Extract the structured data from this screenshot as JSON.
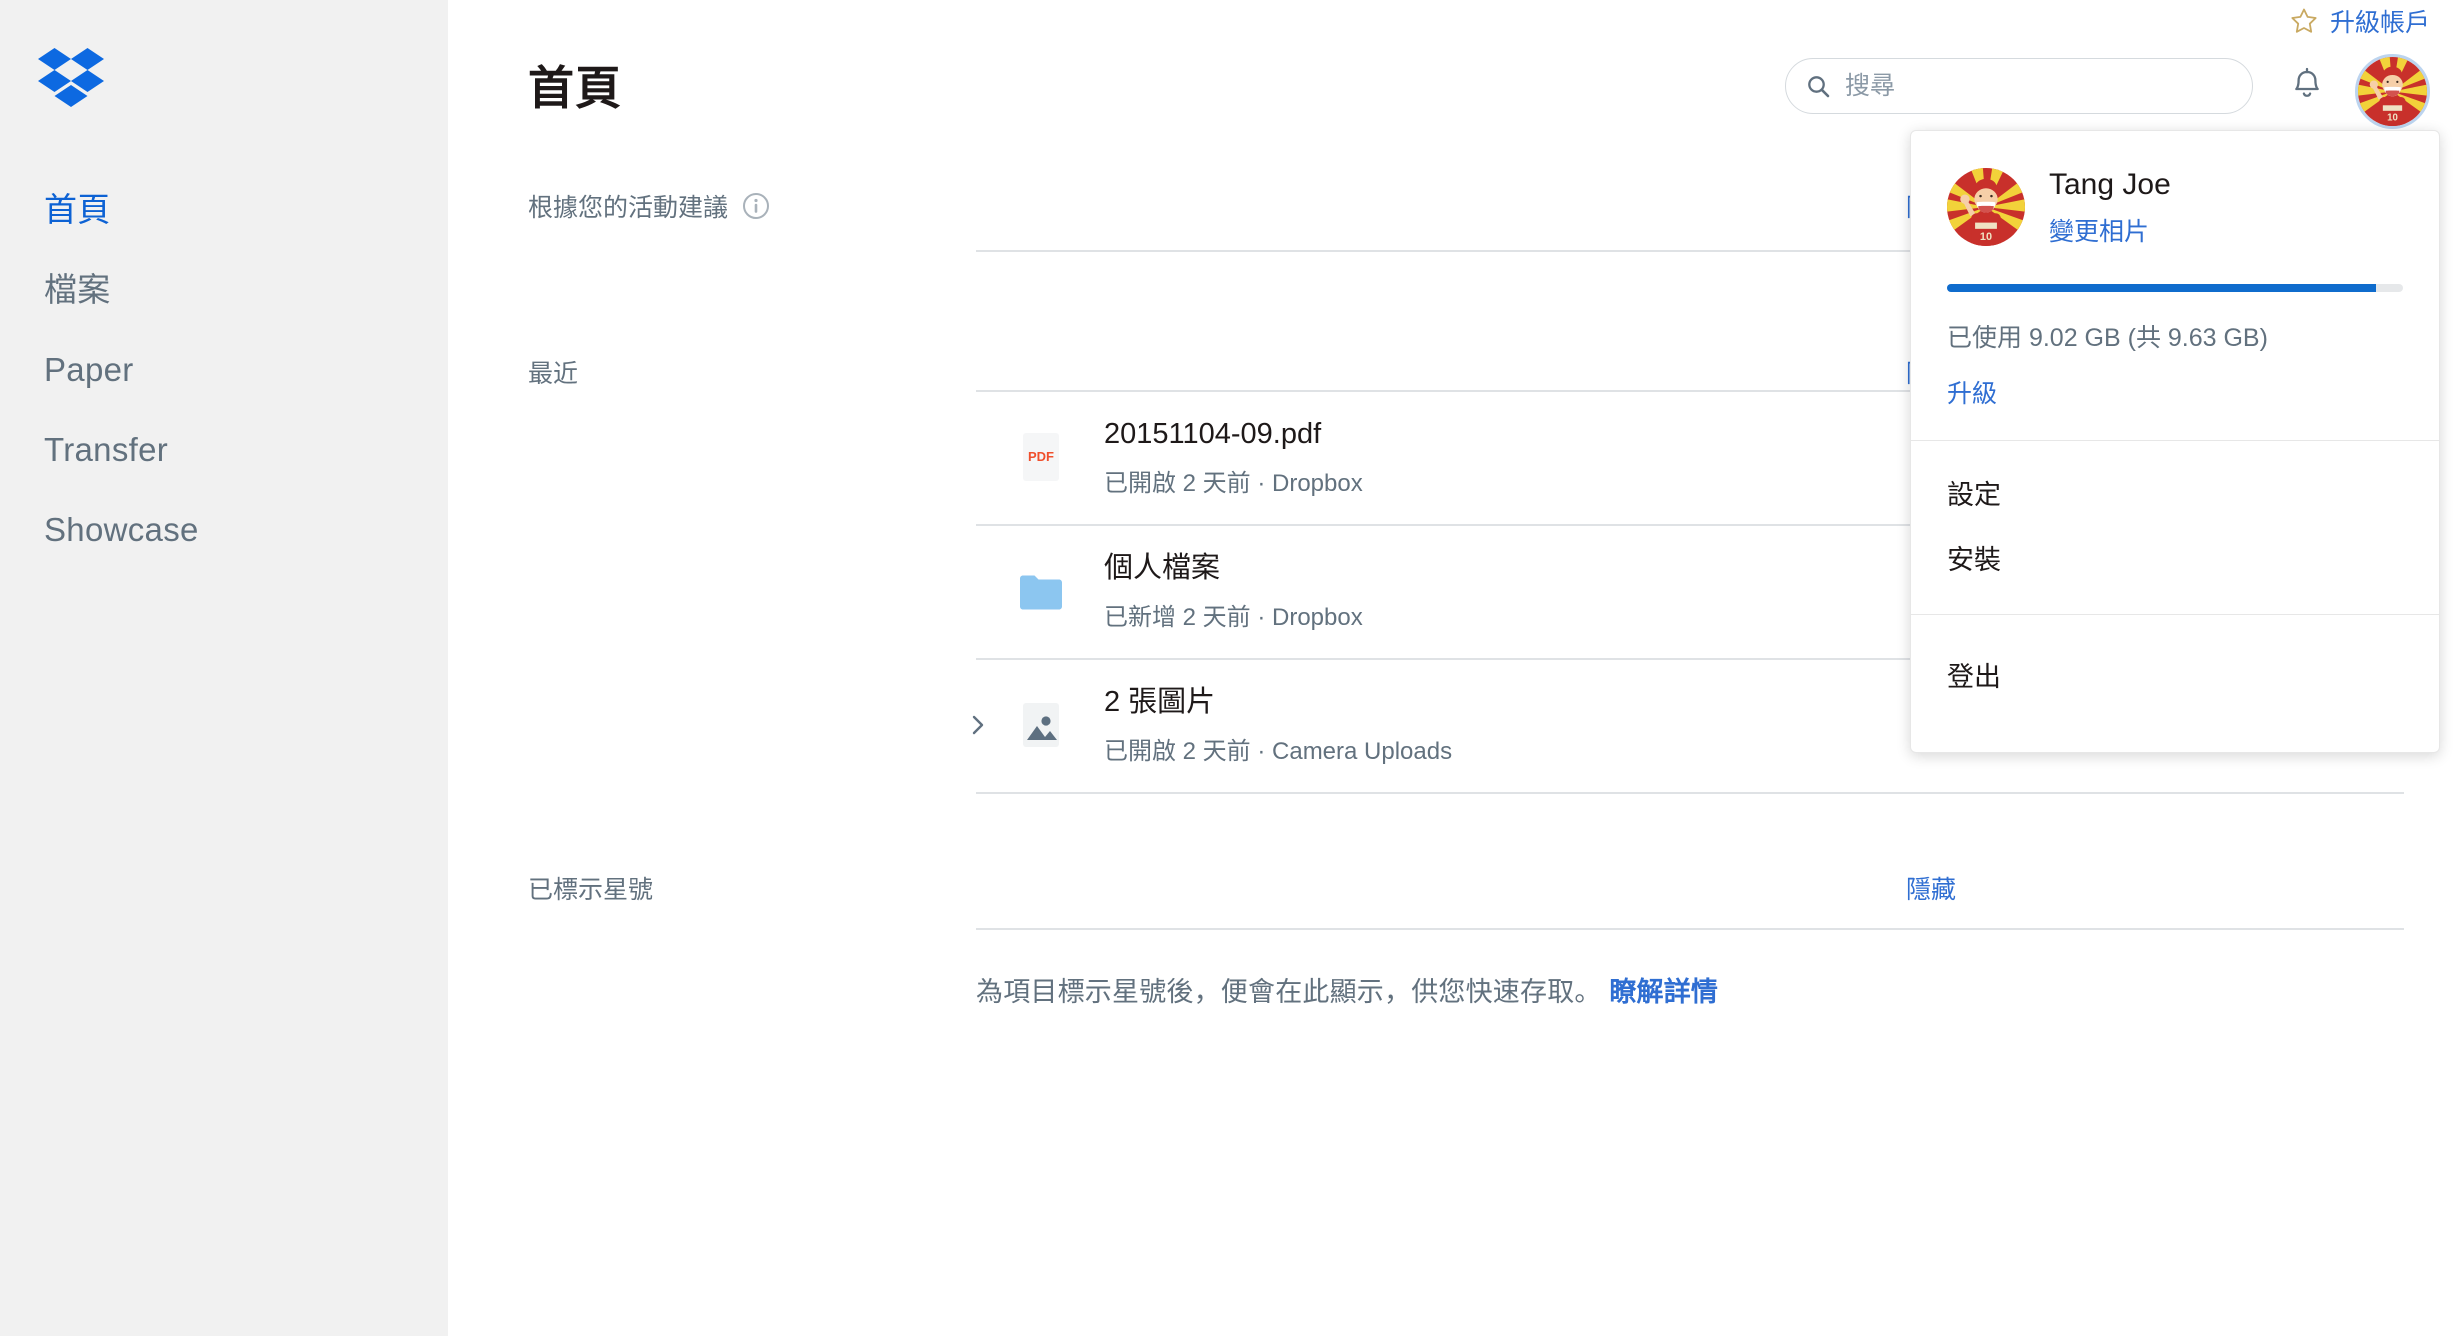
{
  "brand": {
    "logo_name": "dropbox-logo",
    "logo_color": "#0d69e1"
  },
  "sidebar": {
    "items": [
      {
        "label": "首頁",
        "name": "sidebar-item-home",
        "active": true
      },
      {
        "label": "檔案",
        "name": "sidebar-item-files",
        "active": false
      },
      {
        "label": "Paper",
        "name": "sidebar-item-paper",
        "active": false
      },
      {
        "label": "Transfer",
        "name": "sidebar-item-transfer",
        "active": false
      },
      {
        "label": "Showcase",
        "name": "sidebar-item-showcase",
        "active": false
      }
    ]
  },
  "header": {
    "upgrade_label": "升級帳戶",
    "star_icon": "star-icon",
    "star_color": "#c9a961",
    "search_placeholder": "搜尋",
    "search_value": "",
    "search_icon": "search-icon",
    "bell_icon": "bell-icon",
    "avatar_alt": "user-avatar"
  },
  "main": {
    "page_title": "首頁",
    "suggested": {
      "label": "根據您的活動建議",
      "info_icon": "info-icon",
      "hide_label": "隱藏"
    },
    "recent": {
      "label": "最近",
      "hide_label": "隱藏",
      "rows": [
        {
          "name": "20151104-09.pdf",
          "meta": "已開啟 2 天前 · Dropbox",
          "icon": "pdf-file-icon",
          "icon_label": "PDF",
          "has_caret": false,
          "more_icon": "more-options-icon"
        },
        {
          "name": "個人檔案",
          "meta": "已新增 2 天前 · Dropbox",
          "icon": "folder-icon",
          "icon_label": "",
          "has_caret": false,
          "more_icon": "more-options-icon"
        },
        {
          "name": "2 張圖片",
          "meta": "已開啟 2 天前 · Camera Uploads",
          "icon": "image-file-icon",
          "icon_label": "",
          "has_caret": true,
          "more_icon": "more-options-icon"
        }
      ]
    },
    "starred": {
      "label": "已標示星號",
      "hide_label": "隱藏",
      "empty_text": "為項目標示星號後，便會在此顯示，供您快速存取。",
      "empty_link": "瞭解詳情"
    }
  },
  "account_menu": {
    "user_name": "Tang Joe",
    "change_photo_label": "變更相片",
    "storage_text": "已使用 9.02 GB (共 9.63 GB)",
    "storage_percent": 94,
    "upgrade_label": "升級",
    "items": [
      {
        "label": "設定",
        "name": "menu-item-settings"
      },
      {
        "label": "安裝",
        "name": "menu-item-install"
      }
    ],
    "logout_label": "登出",
    "accent_color": "#0f6ccd"
  }
}
